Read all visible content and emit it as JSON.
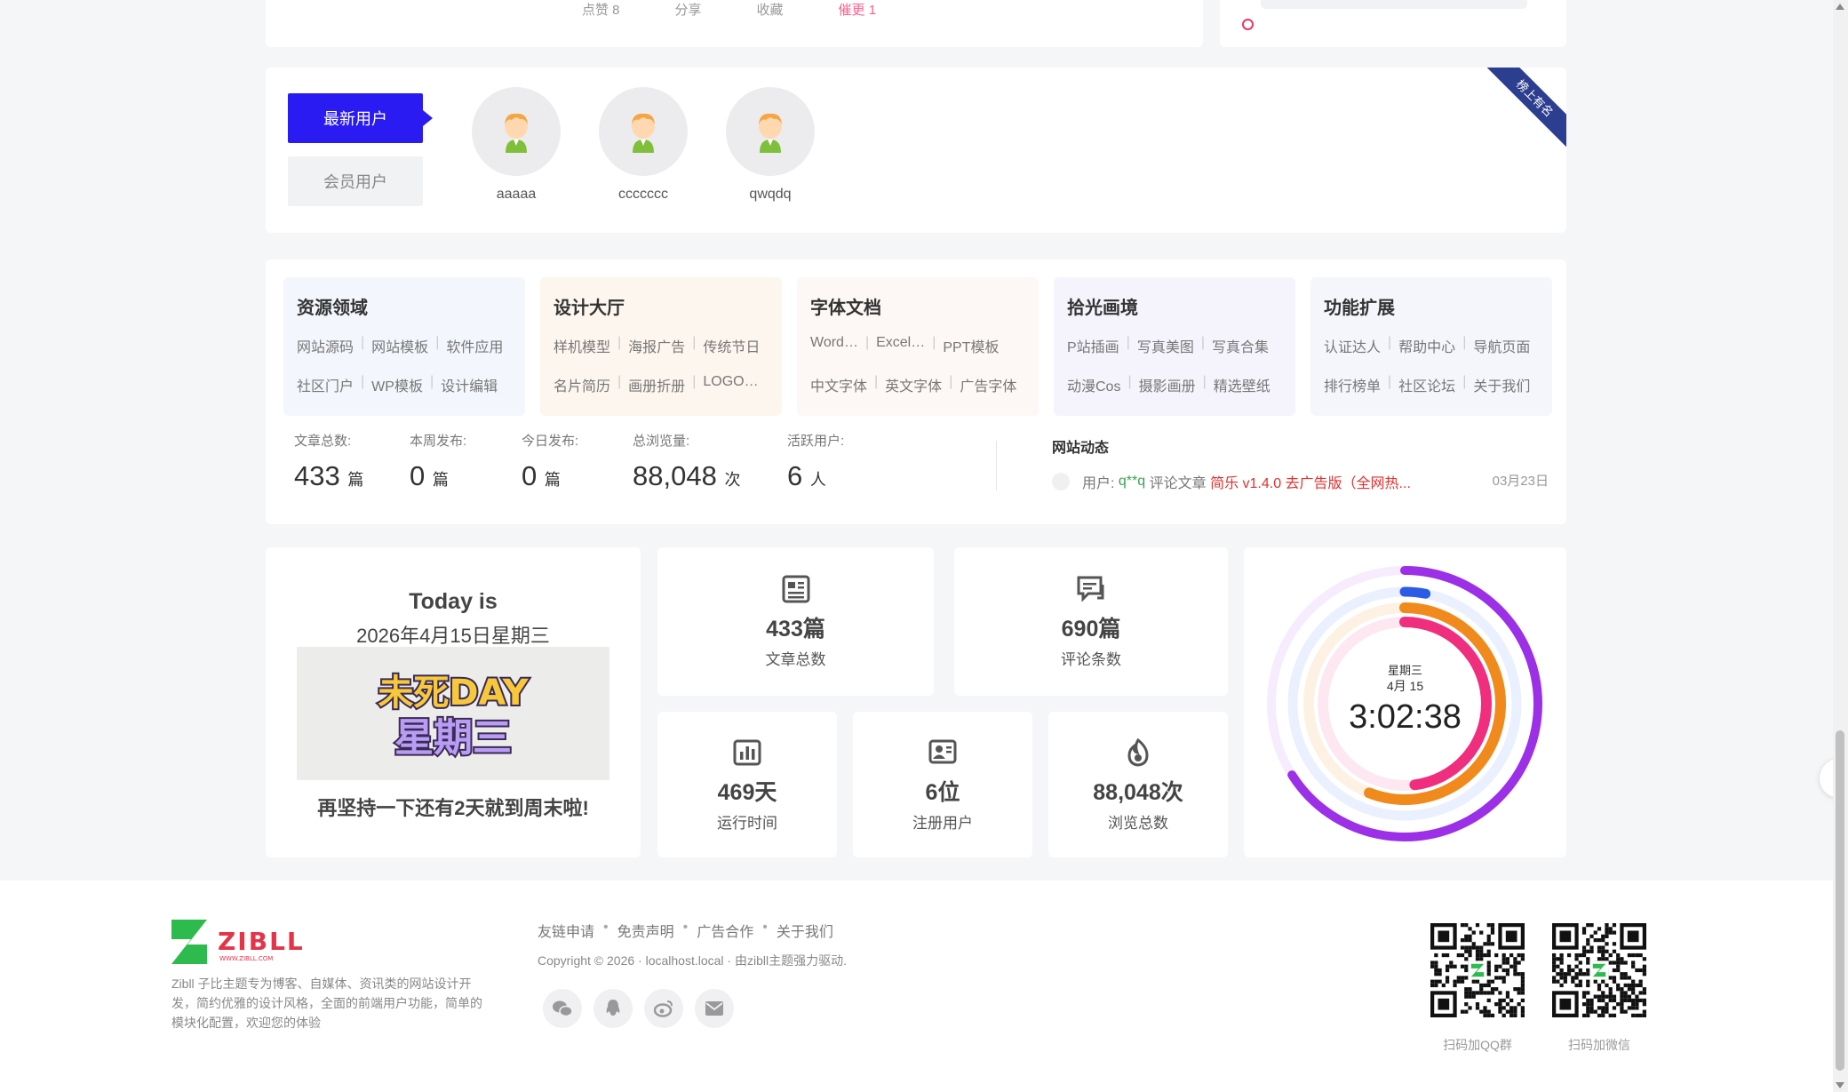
{
  "top_actions": {
    "like": "点赞 8",
    "share": "分享",
    "favorite": "收藏",
    "urge": "催更 1"
  },
  "users": {
    "tab_new": "最新用户",
    "tab_vip": "会员用户",
    "ribbon": "榜上有名",
    "list": [
      {
        "name": "aaaaa"
      },
      {
        "name": "ccccccc"
      },
      {
        "name": "qwqdq"
      }
    ]
  },
  "categories": [
    {
      "title": "资源领域",
      "row1": [
        "网站源码",
        "网站模板",
        "软件应用"
      ],
      "row2": [
        "社区门户",
        "WP模板",
        "设计编辑"
      ],
      "bg": "#f3f6fc"
    },
    {
      "title": "设计大厅",
      "row1": [
        "样机模型",
        "海报广告",
        "传统节日"
      ],
      "row2": [
        "名片简历",
        "画册折册",
        "LOGO…"
      ],
      "bg": "#fdf6ee"
    },
    {
      "title": "字体文档",
      "row1": [
        "Word…",
        "Excel…",
        "PPT模板"
      ],
      "row2": [
        "中文字体",
        "英文字体",
        "广告字体"
      ],
      "bg": "#fdf8f5"
    },
    {
      "title": "拾光画境",
      "row1": [
        "P站插画",
        "写真美图",
        "写真合集"
      ],
      "row2": [
        "动漫Cos",
        "摄影画册",
        "精选壁纸"
      ],
      "bg": "#f5f4fc"
    },
    {
      "title": "功能扩展",
      "row1": [
        "认证达人",
        "帮助中心",
        "导航页面"
      ],
      "row2": [
        "排行榜单",
        "社区论坛",
        "关于我们"
      ],
      "bg": "#f4f6fc"
    }
  ],
  "site_stats": [
    {
      "label": "文章总数:",
      "value": "433",
      "unit": "篇"
    },
    {
      "label": "本周发布:",
      "value": "0",
      "unit": "篇"
    },
    {
      "label": "今日发布:",
      "value": "0",
      "unit": "篇"
    },
    {
      "label": "总浏览量:",
      "value": "88,048",
      "unit": "次"
    },
    {
      "label": "活跃用户:",
      "value": "6",
      "unit": "人"
    }
  ],
  "dynamics": {
    "title": "网站动态",
    "prefix": "用户:",
    "user": "q**q",
    "action": "评论文章",
    "article": "简乐 v1.4.0 去广告版（全网热...",
    "date": "03月23日"
  },
  "today": {
    "title": "Today is",
    "date": "2026年4月15日星期三",
    "image_text_1": "未死DAY",
    "image_text_2": "星期三",
    "message": "再坚持一下还有2天就到周末啦!"
  },
  "stat_cards": [
    {
      "num": "433篇",
      "label": "文章总数",
      "icon": "article-icon"
    },
    {
      "num": "690篇",
      "label": "评论条数",
      "icon": "comment-icon"
    },
    {
      "num": "469天",
      "label": "运行时间",
      "icon": "chart-icon"
    },
    {
      "num": "6位",
      "label": "注册用户",
      "icon": "user-card-icon"
    },
    {
      "num": "88,048次",
      "label": "浏览总数",
      "icon": "fire-icon"
    }
  ],
  "clock": {
    "weekday": "星期三",
    "date": "4月 15",
    "time": "3:02:38",
    "rings": [
      {
        "color": "#9b30e6",
        "fraction": 0.66
      },
      {
        "color": "#2b5ce6",
        "fraction": 0.03
      },
      {
        "color": "#f08a1c",
        "fraction": 0.56
      },
      {
        "color": "#ef2f7d",
        "fraction": 0.48
      }
    ]
  },
  "footer": {
    "logo_text": "ZIBLL",
    "logo_sub": "WWW.ZIBLL.COM",
    "desc": "Zibll 子比主题专为博客、自媒体、资讯类的网站设计开发，简约优雅的设计风格，全面的前端用户功能，简单的模块化配置，欢迎您的体验",
    "links": [
      "友链申请",
      "免责声明",
      "广告合作",
      "关于我们"
    ],
    "copyright": "Copyright © 2026 · localhost.local · 由zibll主题强力驱动.",
    "qr_qq": "扫码加QQ群",
    "qr_wechat": "扫码加微信"
  }
}
